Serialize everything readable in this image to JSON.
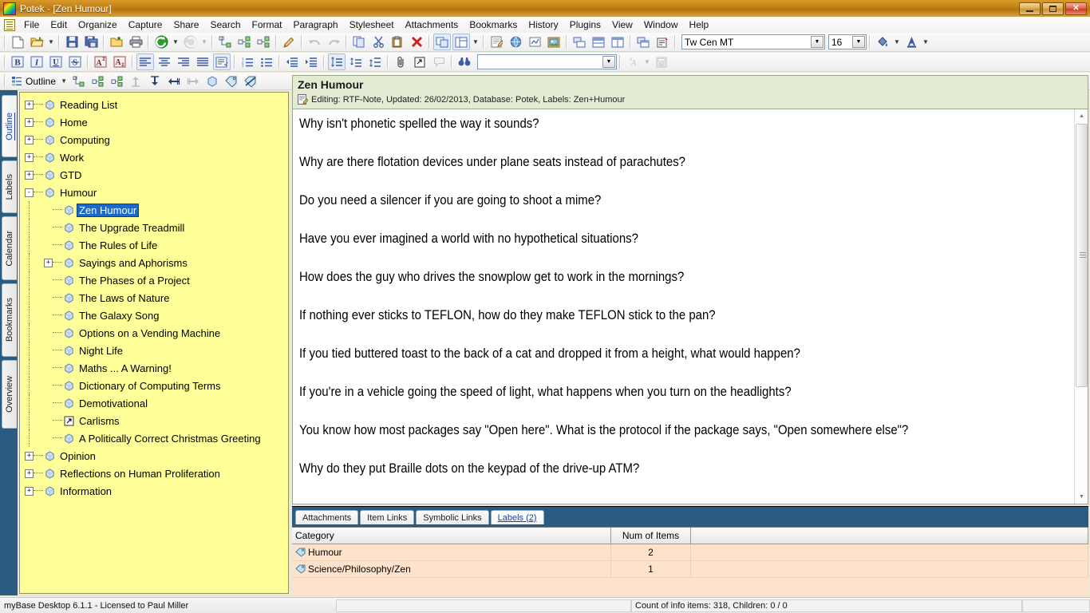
{
  "window": {
    "title": "Potek - [Zen Humour]",
    "app_icon": "app-logo-icon",
    "minimize_label": "Minimize",
    "restore_label": "Restore",
    "close_label": "Close",
    "close_glyph": "✕"
  },
  "menubar": {
    "items": [
      {
        "label": "File",
        "accel": "F"
      },
      {
        "label": "Edit",
        "accel": "E"
      },
      {
        "label": "Organize",
        "accel": "O"
      },
      {
        "label": "Capture",
        "accel": "C"
      },
      {
        "label": "Share",
        "accel": "S"
      },
      {
        "label": "Search",
        "accel": "c"
      },
      {
        "label": "Format",
        "accel": "a"
      },
      {
        "label": "Paragraph",
        "accel": "P"
      },
      {
        "label": "Stylesheet",
        "accel": ""
      },
      {
        "label": "Attachments",
        "accel": "A"
      },
      {
        "label": "Bookmarks",
        "accel": "B"
      },
      {
        "label": "History",
        "accel": "i"
      },
      {
        "label": "Plugins",
        "accel": "l"
      },
      {
        "label": "View",
        "accel": "V"
      },
      {
        "label": "Window",
        "accel": "W"
      },
      {
        "label": "Help",
        "accel": "H"
      }
    ]
  },
  "toolbar_top": {
    "buttons": [
      "new-document-icon",
      "open-folder-icon",
      "open-dropdown-icon",
      "save-icon",
      "save-all-icon",
      "new-folder-icon",
      "print-icon",
      "back-icon",
      "back-dropdown-icon",
      "forward-icon",
      "forward-dropdown-icon",
      "tree-child-icon",
      "tree-sibling-icon",
      "tree-node-icon",
      "edit-pencil-icon",
      "undo-icon",
      "redo-icon",
      "copy-icon",
      "cut-icon",
      "paste-icon",
      "delete-x-icon",
      "layout-overlap-icon",
      "layout-split-icon",
      "layout-dropdown-icon",
      "note-editor-icon",
      "web-browser-icon",
      "scribble-icon",
      "image-viewer-icon",
      "tile-windows-icon",
      "stack-windows-icon",
      "columns-icon",
      "cascade-icon",
      "properties-icon"
    ],
    "font_name": "Tw Cen MT",
    "font_size": "16",
    "fill-color-icon": "fill-color-icon",
    "font-color-icon": "font-color-icon"
  },
  "toolbar_format": {
    "buttons": [
      "bold-icon",
      "italic-icon",
      "underline-icon",
      "strikethrough-icon",
      "superscript-icon",
      "subscript-icon",
      "align-left-icon",
      "align-center-icon",
      "align-right-icon",
      "align-justify-icon",
      "paragraph-format-icon",
      "ordered-list-icon",
      "unordered-list-icon",
      "decrease-indent-icon",
      "increase-indent-icon",
      "line-spacing-icon",
      "space-before-icon",
      "space-after-icon",
      "attachment-clip-icon",
      "hyperlink-icon",
      "comment-icon",
      "find-binoculars-icon"
    ],
    "style_value": "",
    "style_placeholder": "",
    "highlight-icon": "highlight-icon",
    "calculator-icon": "calculator-icon"
  },
  "outline_bar": {
    "label": "Outline",
    "dropdown": "chevron-down-icon",
    "buttons": [
      "add-child-node-icon",
      "add-sibling-node-icon",
      "add-node-icon",
      "move-up-icon",
      "move-down-icon",
      "promote-icon",
      "demote-icon",
      "node-properties-icon",
      "label-tag-icon",
      "clear-labels-icon"
    ]
  },
  "sidebar_tabs": [
    {
      "label": "Outline",
      "active": true
    },
    {
      "label": "Labels",
      "active": false
    },
    {
      "label": "Calendar",
      "active": false
    },
    {
      "label": "Bookmarks",
      "active": false
    },
    {
      "label": "Overview",
      "active": false
    }
  ],
  "tree": {
    "items": [
      {
        "label": "Reading List",
        "depth": 0,
        "toggle": "+",
        "icon": "note-node-icon",
        "selected": false
      },
      {
        "label": "Home",
        "depth": 0,
        "toggle": "+",
        "icon": "note-node-icon",
        "selected": false
      },
      {
        "label": "Computing",
        "depth": 0,
        "toggle": "+",
        "icon": "note-node-icon",
        "selected": false
      },
      {
        "label": "Work",
        "depth": 0,
        "toggle": "+",
        "icon": "note-node-icon",
        "selected": false
      },
      {
        "label": "GTD",
        "depth": 0,
        "toggle": "+",
        "icon": "note-node-icon",
        "selected": false
      },
      {
        "label": "Humour",
        "depth": 0,
        "toggle": "-",
        "icon": "note-node-icon",
        "selected": false
      },
      {
        "label": "Zen Humour",
        "depth": 1,
        "toggle": "",
        "icon": "note-node-icon",
        "selected": true
      },
      {
        "label": "The Upgrade Treadmill",
        "depth": 1,
        "toggle": "",
        "icon": "note-node-icon",
        "selected": false
      },
      {
        "label": "The Rules of Life",
        "depth": 1,
        "toggle": "",
        "icon": "note-node-icon",
        "selected": false
      },
      {
        "label": "Sayings and Aphorisms",
        "depth": 1,
        "toggle": "+",
        "icon": "note-node-icon",
        "selected": false
      },
      {
        "label": "The Phases of a Project",
        "depth": 1,
        "toggle": "",
        "icon": "note-node-icon",
        "selected": false
      },
      {
        "label": "The Laws of Nature",
        "depth": 1,
        "toggle": "",
        "icon": "note-node-icon",
        "selected": false
      },
      {
        "label": "The Galaxy Song",
        "depth": 1,
        "toggle": "",
        "icon": "note-node-icon",
        "selected": false
      },
      {
        "label": "Options on a Vending Machine",
        "depth": 1,
        "toggle": "",
        "icon": "note-node-icon",
        "selected": false
      },
      {
        "label": "Night Life",
        "depth": 1,
        "toggle": "",
        "icon": "note-node-icon",
        "selected": false
      },
      {
        "label": "Maths ... A Warning!",
        "depth": 1,
        "toggle": "",
        "icon": "note-node-icon",
        "selected": false
      },
      {
        "label": "Dictionary of Computing Terms",
        "depth": 1,
        "toggle": "",
        "icon": "note-node-icon",
        "selected": false
      },
      {
        "label": "Demotivational",
        "depth": 1,
        "toggle": "",
        "icon": "note-node-icon",
        "selected": false
      },
      {
        "label": "Carlisms",
        "depth": 1,
        "toggle": "",
        "icon": "shortcut-node-icon",
        "selected": false
      },
      {
        "label": "A Politically Correct Christmas Greeting",
        "depth": 1,
        "toggle": "",
        "icon": "note-node-icon",
        "selected": false
      },
      {
        "label": "Opinion",
        "depth": 0,
        "toggle": "+",
        "icon": "note-node-icon",
        "selected": false
      },
      {
        "label": "Reflections on Human Proliferation",
        "depth": 0,
        "toggle": "+",
        "icon": "note-node-icon",
        "selected": false
      },
      {
        "label": "Information",
        "depth": 0,
        "toggle": "+",
        "icon": "note-node-icon",
        "selected": false
      }
    ]
  },
  "note": {
    "title": "Zen Humour",
    "meta": "Editing: RTF-Note, Updated: 26/02/2013, Database: Potek, Labels: Zen+Humour",
    "meta_icon": "note-edit-icon",
    "paragraphs": [
      "Why isn't phonetic spelled the way it sounds?",
      "Why are there flotation devices under plane seats instead of parachutes?",
      "Do you need a silencer if you are going to shoot a mime?",
      "Have you ever imagined a world with no hypothetical situations?",
      "How does the guy who drives the snowplow get to work in the mornings?",
      "If nothing ever sticks to TEFLON, how do they make TEFLON stick to the pan?",
      "If you tied buttered toast to the back of a cat and dropped it from a height, what would happen?",
      "If you're in a vehicle going the speed of light, what happens when you turn on the headlights?",
      "You know how most packages say \"Open here\". What is the protocol if the package says, \"Open somewhere else\"?",
      "Why do they put Braille dots on the keypad of the drive-up ATM?"
    ]
  },
  "bottom_panel": {
    "tabs": [
      {
        "label": "Attachments",
        "active": false
      },
      {
        "label": "Item Links",
        "active": false
      },
      {
        "label": "Symbolic Links",
        "active": false
      },
      {
        "label": "Labels (2)",
        "active": true
      }
    ],
    "grid": {
      "columns": [
        "Category",
        "Num of Items",
        ""
      ],
      "rows": [
        {
          "icon": "label-tag-icon",
          "category": "Humour",
          "num": "2",
          "extra": ""
        },
        {
          "icon": "label-tag-icon",
          "category": "Science/Philosophy/Zen",
          "num": "1",
          "extra": ""
        }
      ]
    }
  },
  "statusbar": {
    "license": "myBase Desktop 6.1.1 - Licensed to Paul Miller",
    "cell2": "",
    "count": "Count of info items: 318, Children: 0 / 0",
    "cell4": ""
  },
  "colors": {
    "title_bar": "#c07f14",
    "tree_background": "#ffff99",
    "selection": "#1b6ac9",
    "panel_blue": "#2a5b80",
    "grid_rows": "#fde3cb",
    "note_header": "#e3ecd3"
  }
}
